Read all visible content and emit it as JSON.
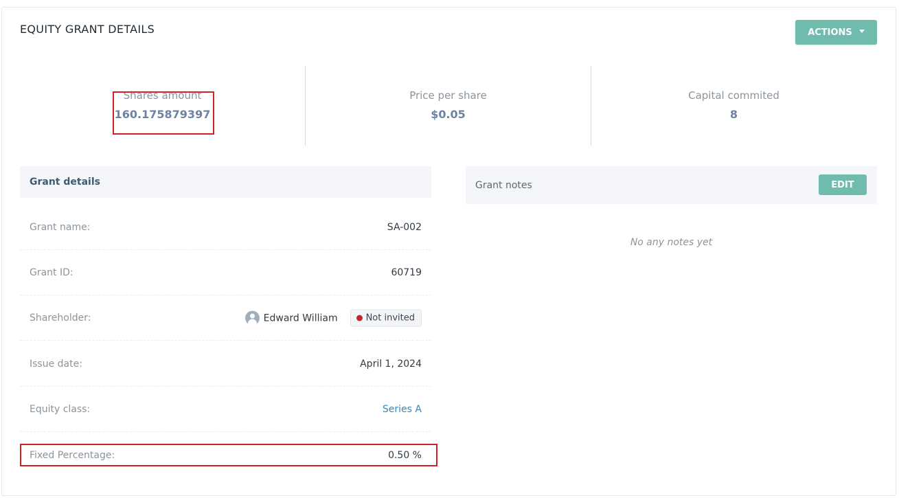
{
  "page": {
    "title": "EQUITY GRANT DETAILS",
    "actions_label": "ACTIONS"
  },
  "stats": [
    {
      "label": "Shares amount",
      "value": "160.175879397"
    },
    {
      "label": "Price per share",
      "value": "$0.05"
    },
    {
      "label": "Capital commited",
      "value": "8"
    }
  ],
  "grant_details": {
    "heading": "Grant details",
    "rows": {
      "grant_name": {
        "label": "Grant name:",
        "value": "SA-002"
      },
      "grant_id": {
        "label": "Grant ID:",
        "value": "60719"
      },
      "shareholder": {
        "label": "Shareholder:",
        "name": "Edward William",
        "status": "Not invited"
      },
      "issue_date": {
        "label": "Issue date:",
        "value": "April 1, 2024"
      },
      "equity_class": {
        "label": "Equity class:",
        "value": "Series A"
      },
      "fixed_percentage": {
        "label": "Fixed Percentage:",
        "value": "0.50 %"
      }
    }
  },
  "grant_notes": {
    "heading": "Grant notes",
    "edit_label": "EDIT",
    "empty_text": "No any notes yet"
  },
  "colors": {
    "accent": "#6fbbad",
    "highlight": "#d42025",
    "status_dot": "#c0282d",
    "link": "#3a86b3"
  },
  "icons": {
    "actions_caret": "caret-down-icon",
    "shareholder_avatar": "user-avatar-icon",
    "status_dot": "status-dot-icon"
  }
}
